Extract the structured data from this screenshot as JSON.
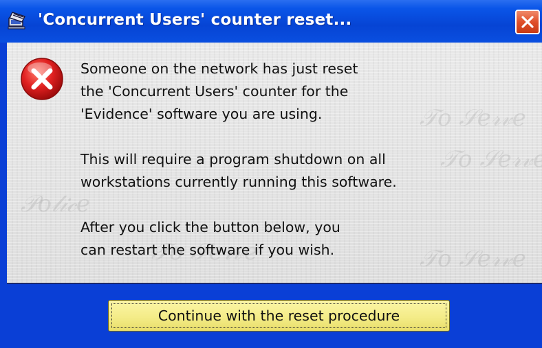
{
  "window": {
    "title": "'Concurrent Users' counter reset...",
    "title_icon": "network-computers-icon",
    "close_icon": "close-icon"
  },
  "message": {
    "icon": "error-icon",
    "paragraphs": [
      [
        "Someone on the network has just reset",
        "the 'Concurrent Users' counter for the",
        "'Evidence' software you are using."
      ],
      [
        "This will require a program shutdown on all",
        "workstations currently running this software."
      ],
      [
        "After you click the button below, you",
        "can restart the software if you wish."
      ]
    ]
  },
  "buttons": {
    "continue_label": "Continue with the reset procedure"
  },
  "colors": {
    "titlebar": "#0a55e8",
    "frame": "#0a3fd6",
    "content_bg": "#e4e4e4",
    "button_bg": "#f4ec88",
    "close_btn": "#e0502a",
    "error_red": "#d01818"
  }
}
